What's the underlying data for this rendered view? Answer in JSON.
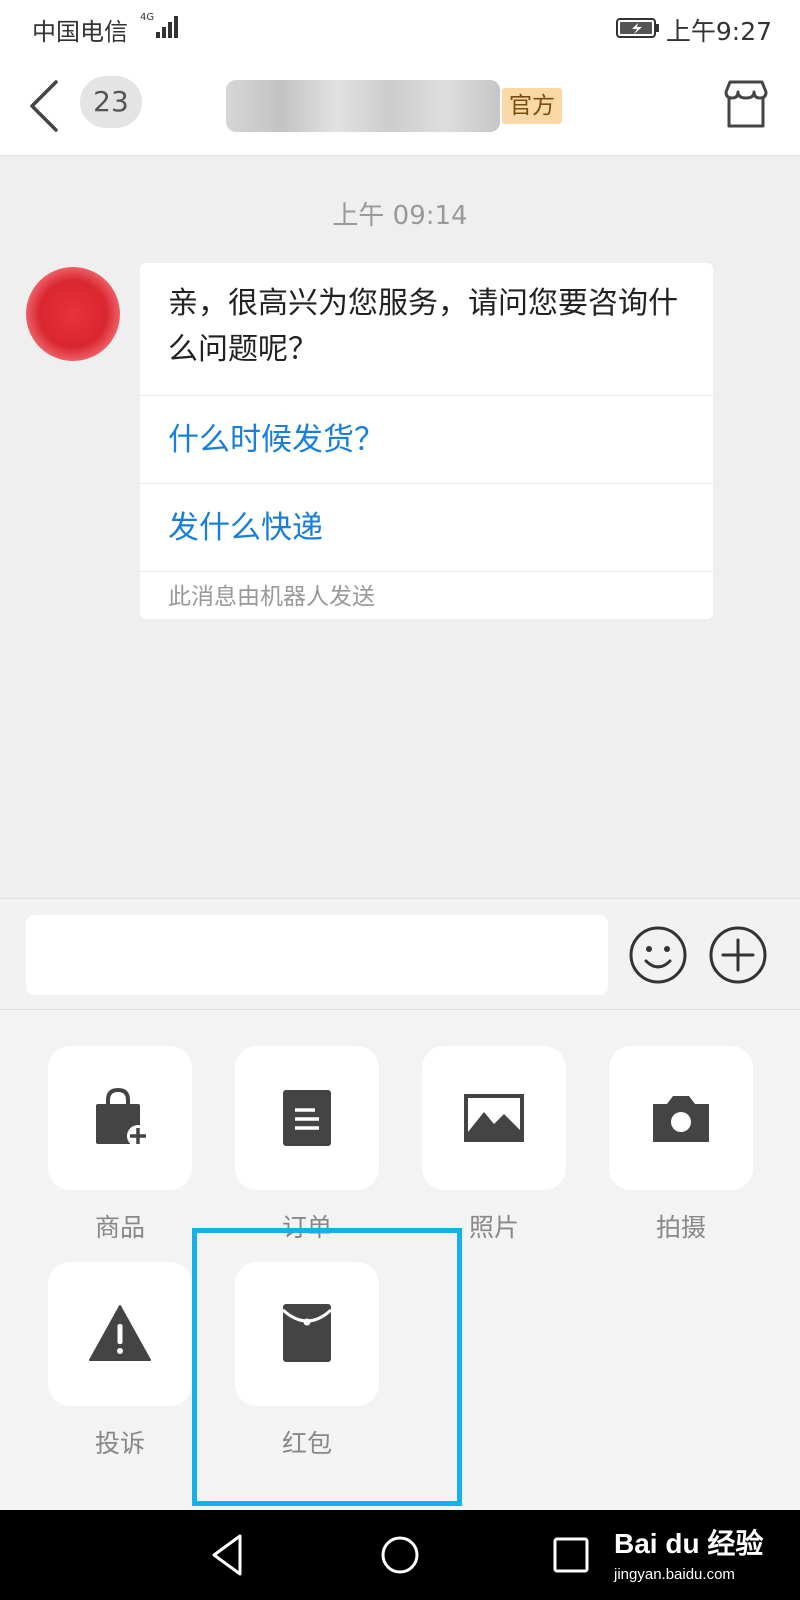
{
  "status_bar": {
    "carrier": "中国电信",
    "network": "4G",
    "time": "上午9:27",
    "icons": [
      "signal-icon",
      "battery-icon"
    ]
  },
  "header": {
    "unread_count": "23",
    "badge": "官方",
    "icons": [
      "back-arrow-icon",
      "store-icon"
    ]
  },
  "chat": {
    "timestamp": "上午 09:14",
    "message": {
      "text": "亲，很高兴为您服务，请问您要咨询什么问题呢？",
      "quick_questions": [
        "什么时候发货？",
        "发什么快递"
      ],
      "note": "此消息由机器人发送"
    }
  },
  "input_bar": {
    "value": "",
    "placeholder": "",
    "icons": [
      "emoji-icon",
      "plus-circle-icon"
    ]
  },
  "tools": [
    {
      "label": "商品",
      "icon": "shopping-bag-add-icon"
    },
    {
      "label": "订单",
      "icon": "document-list-icon"
    },
    {
      "label": "照片",
      "icon": "image-icon"
    },
    {
      "label": "拍摄",
      "icon": "camera-icon"
    },
    {
      "label": "投诉",
      "icon": "warning-triangle-icon"
    },
    {
      "label": "红包",
      "icon": "red-packet-icon"
    }
  ],
  "highlight_color": "#16b2e6",
  "link_color": "#1a7fd9",
  "system_nav": {
    "icons": [
      "back-triangle-icon",
      "home-circle-icon",
      "recent-square-icon"
    ]
  },
  "watermark": {
    "brand": "Bai du 经验",
    "url": "jingyan.baidu.com"
  }
}
